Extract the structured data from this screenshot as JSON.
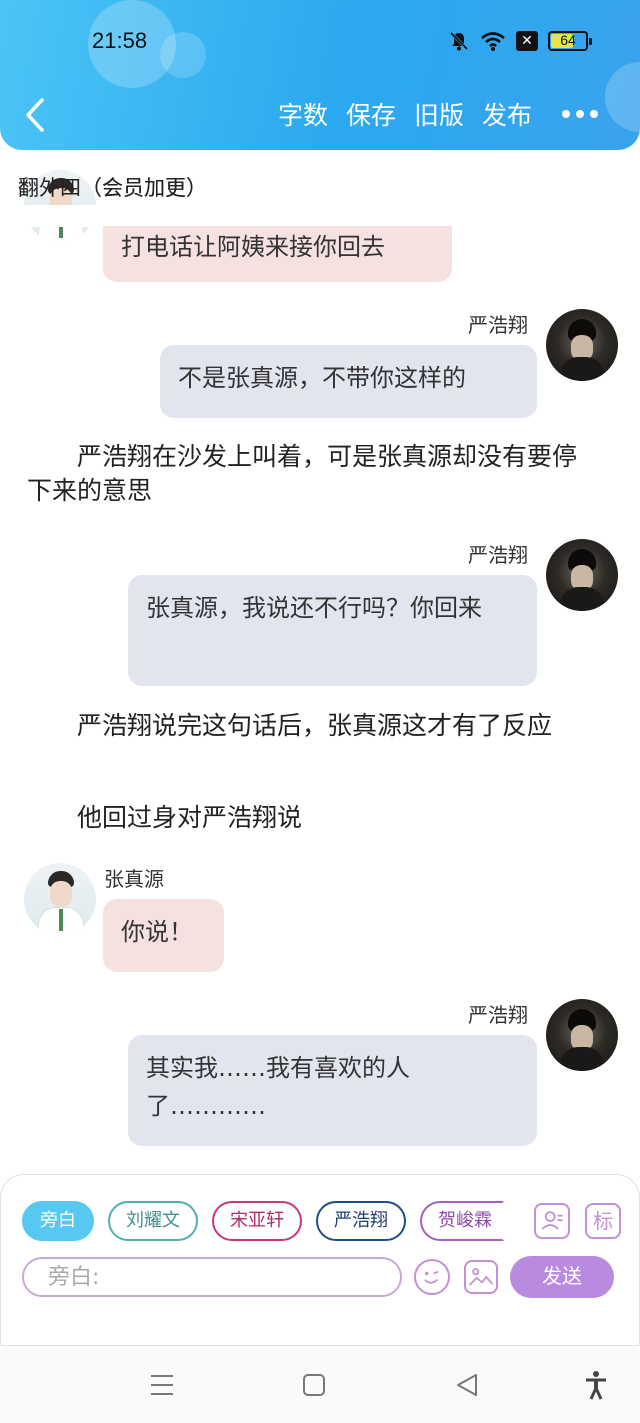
{
  "status_bar": {
    "time": "21:58",
    "battery": "64"
  },
  "header": {
    "toolbar": [
      "字数",
      "保存",
      "旧版",
      "发布"
    ]
  },
  "chapter_title": "翻外四（会员加更）",
  "messages": {
    "m1_text": "打电话让阿姨来接你回去",
    "m2_speaker": "严浩翔",
    "m2_text": "不是张真源，不带你这样的",
    "n1": "严浩翔在沙发上叫着，可是张真源却没有要停下来的意思",
    "m3_speaker": "严浩翔",
    "m3_text": "张真源，我说还不行吗？你回来",
    "n2": "严浩翔说完这句话后，张真源这才有了反应",
    "n3": "他回过身对严浩翔说",
    "m4_speaker": "张真源",
    "m4_text": "你说！",
    "m5_speaker": "严浩翔",
    "m5_text": "其实我……我有喜欢的人了…………"
  },
  "composer": {
    "roles": [
      "旁白",
      "刘耀文",
      "宋亚轩",
      "严浩翔",
      "贺峻霖"
    ],
    "mark_label": "标",
    "input_placeholder": "旁白:",
    "send_label": "发送"
  },
  "colors": {
    "header_start": "#4cc4f5",
    "header_end": "#2aa8f0",
    "pink_bubble": "#f6e1e1",
    "gray_bubble": "#e2e5ee",
    "send": "#b98be0"
  }
}
